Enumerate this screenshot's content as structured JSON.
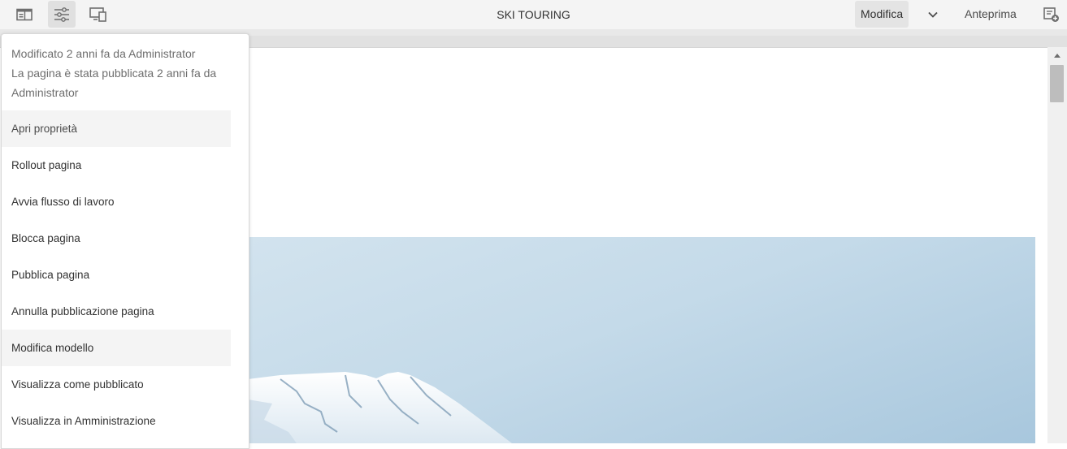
{
  "toolbar": {
    "title": "SKI TOURING",
    "mode_edit": "Modifica",
    "mode_preview": "Anteprima",
    "icons": [
      "side-panel-icon",
      "page-info-icon",
      "emulator-icon",
      "chevron-down-icon",
      "annotations-icon"
    ]
  },
  "page_info": {
    "modified": "Modificato 2 anni fa da Administrator",
    "published": "La pagina è stata pubblicata 2 anni fa da Administrator",
    "items": [
      {
        "label": "Apri proprietà"
      },
      {
        "label": "Rollout pagina"
      },
      {
        "label": "Avvia flusso di lavoro"
      },
      {
        "label": "Blocca pagina"
      },
      {
        "label": "Pubblica pagina"
      },
      {
        "label": "Annulla pubblicazione pagina"
      },
      {
        "label": "Modifica modello"
      },
      {
        "label": "Visualizza come pubblicato"
      },
      {
        "label": "Visualizza in Amministrazione"
      }
    ]
  },
  "colors": {
    "toolbar_bg": "#f4f4f4",
    "active_bg": "#e0e0e0",
    "sky": "#c4dae9"
  }
}
